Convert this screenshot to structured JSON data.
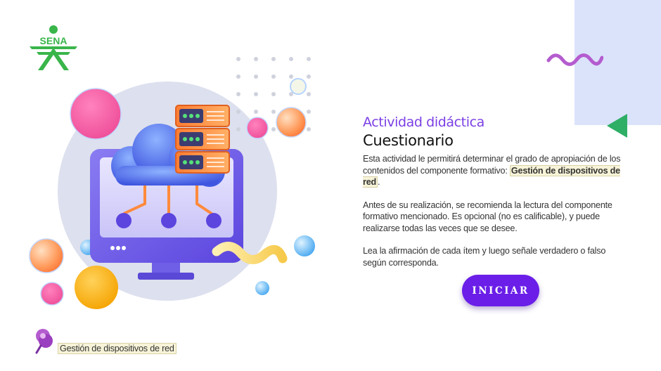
{
  "brand": {
    "logo_text": "SENA"
  },
  "content": {
    "eyebrow": "Actividad didáctica",
    "title": "Cuestionario",
    "p1_before": "Esta actividad le permitirá determinar el grado de apropiación de los contenidos del componente formativo: ",
    "p1_highlight": "Gestión de dispositivos de red",
    "p1_after": ".",
    "p2": "Antes de su realización, se recomienda la lectura del componente formativo mencionado.  Es opcional (no es calificable), y puede realizarse todas las veces que se desee.",
    "p3": "Lea la afirmación de cada ítem y luego señale verdadero o falso según corresponda."
  },
  "actions": {
    "start_label": "INICIAR"
  },
  "footer": {
    "component_label": "Gestión de dispositivos de red"
  },
  "colors": {
    "accent": "#7b3fe4",
    "button": "#6a1ee8",
    "logo_green": "#39b54a",
    "triangle_green": "#2fae66",
    "wave_purple": "#b45ccf",
    "panel_blue": "#dbe3fb"
  },
  "icons": [
    "sena-logo",
    "cloud-server-illustration",
    "map-pin-icon",
    "wave-icon",
    "triangle-icon"
  ]
}
